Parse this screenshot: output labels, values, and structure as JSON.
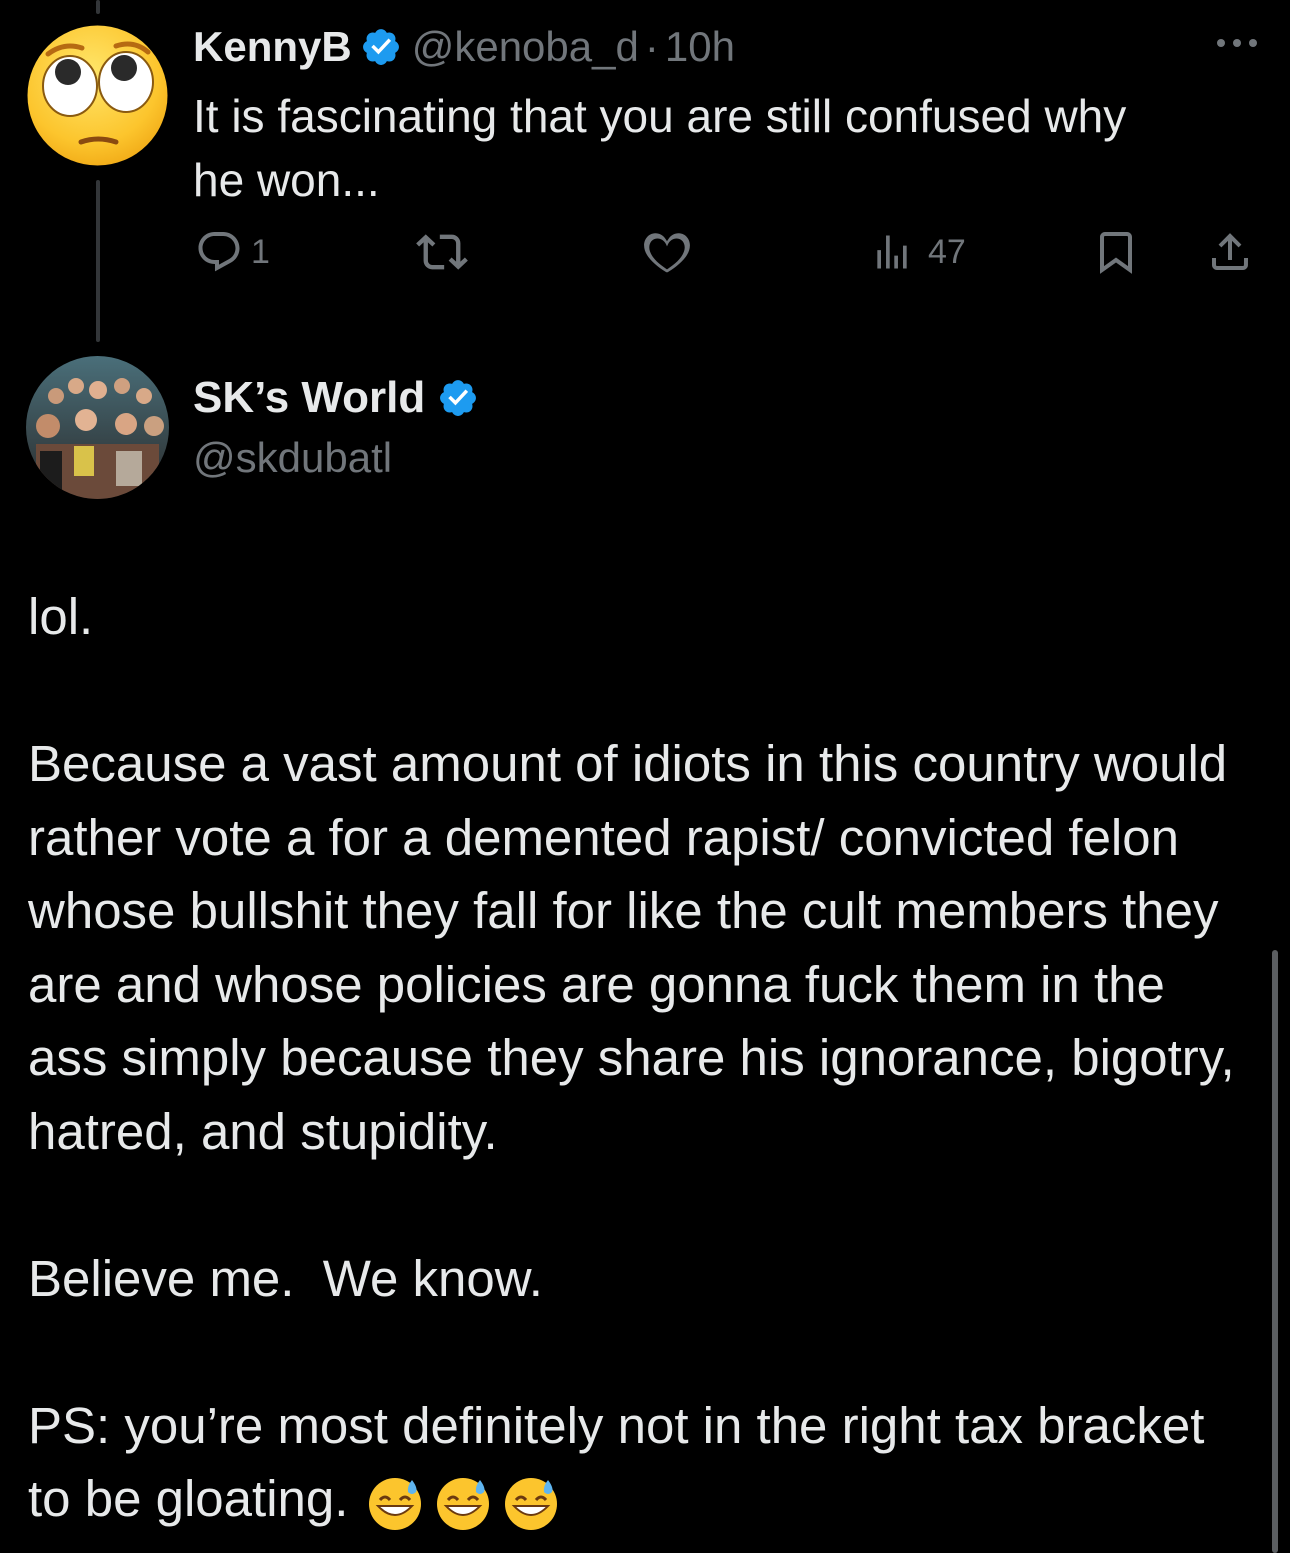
{
  "reply": {
    "display_name": "KennyB",
    "handle": "@kenoba_d",
    "separator": "·",
    "time": "10h",
    "text_line1": "It is fascinating that you are still confused why",
    "text_line2": "he won...",
    "avatar_icon": "rolling-eyes-emoji-icon",
    "actions": {
      "reply_count": "1",
      "retweet_count": "",
      "like_count": "",
      "views_count": "47"
    }
  },
  "tweet": {
    "display_name": "SK’s World",
    "handle": "@skdubatl",
    "paragraphs": [
      "lol.",
      "Because a vast amount of idiots in this country would rather vote a for a demented rapist/ convicted felon whose bullshit they fall for like the cult members they are and whose policies are gonna fuck them in the ass simply because they share his ignorance, bigotry, hatred, and stupidity.",
      "Believe me.  We know.",
      "PS: you’re most definitely not in the right tax bracket to be gloating."
    ],
    "trailing_emojis": "😅😅😅"
  },
  "colors": {
    "background": "#000000",
    "text_primary": "#e7e9ea",
    "text_secondary": "#71767b",
    "verified_blue": "#1d9bf0",
    "thread_line": "#333639"
  }
}
